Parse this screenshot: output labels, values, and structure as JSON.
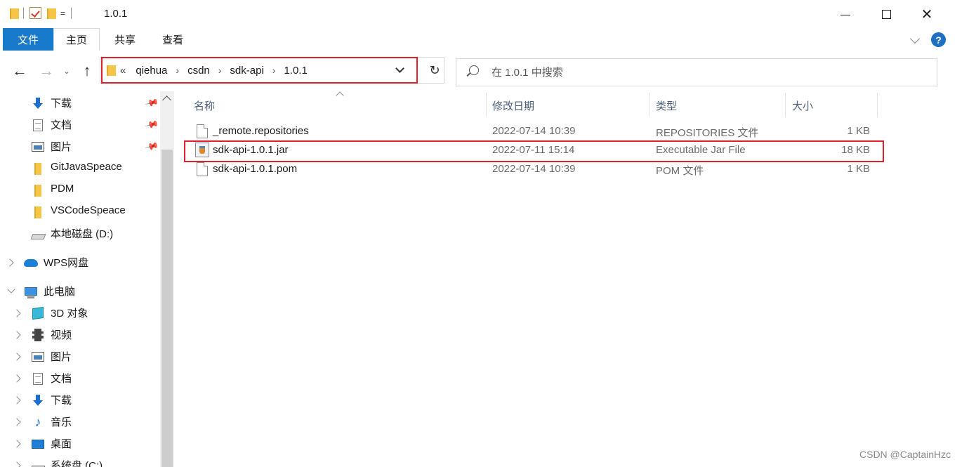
{
  "window": {
    "title": "1.0.1",
    "qa_dropdown": "=",
    "minimize_label": "",
    "close_glyph": "✕"
  },
  "ribbon": {
    "tabs": [
      "文件",
      "主页",
      "共享",
      "查看"
    ],
    "help": "?"
  },
  "nav": {
    "back": "←",
    "forward": "→",
    "recent": "⌄",
    "up": "↑"
  },
  "address": {
    "overflow": "«",
    "separator": "›",
    "crumbs": [
      "qiehua",
      "csdn",
      "sdk-api",
      "1.0.1"
    ],
    "refresh": "↻"
  },
  "search": {
    "placeholder": "在 1.0.1 中搜索"
  },
  "sidebar": {
    "quick_access": [
      {
        "label": "下载",
        "icon": "download-icon",
        "pinned": true
      },
      {
        "label": "文档",
        "icon": "document-icon",
        "pinned": true
      },
      {
        "label": "图片",
        "icon": "picture-icon",
        "pinned": true
      },
      {
        "label": "GitJavaSpeace",
        "icon": "folder-icon",
        "pinned": false
      },
      {
        "label": "PDM",
        "icon": "folder-icon",
        "pinned": false
      },
      {
        "label": "VSCodeSpeace",
        "icon": "folder-icon",
        "pinned": false
      },
      {
        "label": "本地磁盘 (D:)",
        "icon": "drive-icon",
        "pinned": false
      }
    ],
    "wps": {
      "label": "WPS网盘",
      "icon": "cloud-icon"
    },
    "this_pc": {
      "label": "此电脑",
      "icon": "computer-icon"
    },
    "pc_items": [
      {
        "label": "3D 对象",
        "icon": "3d-objects-icon"
      },
      {
        "label": "视频",
        "icon": "video-icon"
      },
      {
        "label": "图片",
        "icon": "picture-icon"
      },
      {
        "label": "文档",
        "icon": "document-icon"
      },
      {
        "label": "下载",
        "icon": "download-icon"
      },
      {
        "label": "音乐",
        "icon": "music-icon"
      },
      {
        "label": "桌面",
        "icon": "desktop-icon"
      },
      {
        "label": "系统盘 (C:)",
        "icon": "system-drive-icon"
      }
    ],
    "pin_glyph": "📌",
    "music_glyph": "♪"
  },
  "files": {
    "columns": [
      "名称",
      "修改日期",
      "类型",
      "大小"
    ],
    "rows": [
      {
        "name": "_remote.repositories",
        "modified": "2022-07-14 10:39",
        "type": "REPOSITORIES 文件",
        "size": "1 KB",
        "icon": "file-icon"
      },
      {
        "name": "sdk-api-1.0.1.jar",
        "modified": "2022-07-11 15:14",
        "type": "Executable Jar File",
        "size": "18 KB",
        "icon": "jar-file-icon"
      },
      {
        "name": "sdk-api-1.0.1.pom",
        "modified": "2022-07-14 10:39",
        "type": "POM 文件",
        "size": "1 KB",
        "icon": "file-icon"
      }
    ]
  },
  "watermark": "CSDN @CaptainHzc",
  "colors": {
    "accent": "#1979ca",
    "highlight": "#e0202a",
    "folder": "#f4c547"
  }
}
